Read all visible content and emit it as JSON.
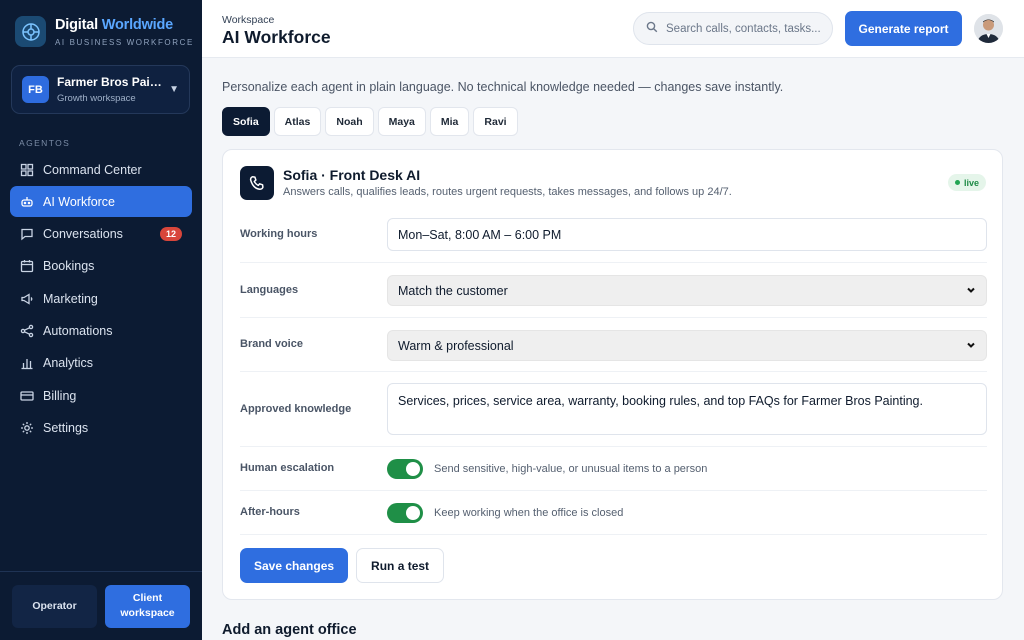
{
  "brand": {
    "name_part1": "Digital",
    "name_part2": "Worldwide",
    "subtitle": "AI BUSINESS WORKFORCE"
  },
  "workspace": {
    "initials": "FB",
    "name": "Farmer Bros Painting",
    "plan": "Growth workspace"
  },
  "sidebar": {
    "section_label": "AGENTOS",
    "items": [
      {
        "label": "Command Center",
        "icon": "grid-icon"
      },
      {
        "label": "AI Workforce",
        "icon": "robot-icon",
        "active": true
      },
      {
        "label": "Conversations",
        "icon": "chat-icon",
        "badge": "12"
      },
      {
        "label": "Bookings",
        "icon": "calendar-icon"
      },
      {
        "label": "Marketing",
        "icon": "megaphone-icon"
      },
      {
        "label": "Automations",
        "icon": "share-nodes-icon"
      },
      {
        "label": "Analytics",
        "icon": "bar-chart-icon"
      },
      {
        "label": "Billing",
        "icon": "credit-card-icon"
      },
      {
        "label": "Settings",
        "icon": "gear-icon"
      }
    ],
    "footer": {
      "operator_label": "Operator",
      "client_label": "Client workspace"
    }
  },
  "header": {
    "breadcrumb": "Workspace",
    "title": "AI Workforce",
    "search_placeholder": "Search calls, contacts, tasks...",
    "report_button": "Generate report"
  },
  "main": {
    "intro": "Personalize each agent in plain language. No technical knowledge needed — changes save instantly.",
    "agent_tabs": [
      "Sofia",
      "Atlas",
      "Noah",
      "Maya",
      "Mia",
      "Ravi"
    ],
    "active_tab": "Sofia",
    "agent": {
      "name": "Sofia · Front Desk AI",
      "description": "Answers calls, qualifies leads, routes urgent requests, takes messages, and follows up 24/7.",
      "status": "live"
    },
    "fields": {
      "working_hours": {
        "label": "Working hours",
        "value": "Mon–Sat, 8:00 AM – 6:00 PM"
      },
      "languages": {
        "label": "Languages",
        "value": "Match the customer"
      },
      "brand_voice": {
        "label": "Brand voice",
        "value": "Warm & professional"
      },
      "knowledge": {
        "label": "Approved knowledge",
        "value": "Services, prices, service area, warranty, booking rules, and top FAQs for Farmer Bros Painting."
      },
      "escalation": {
        "label": "Human escalation",
        "description": "Send sensitive, high-value, or unusual items to a person",
        "enabled": true
      },
      "after_hours": {
        "label": "After-hours",
        "description": "Keep working when the office is closed",
        "enabled": true
      }
    },
    "save_button": "Save changes",
    "test_button": "Run a test",
    "next_section_title": "Add an agent office"
  },
  "colors": {
    "sidebar_bg": "#0c1b33",
    "accent": "#2f6ee0",
    "live_green": "#22a553",
    "toggle_on": "#1f8f47",
    "badge_red": "#d8463b"
  }
}
